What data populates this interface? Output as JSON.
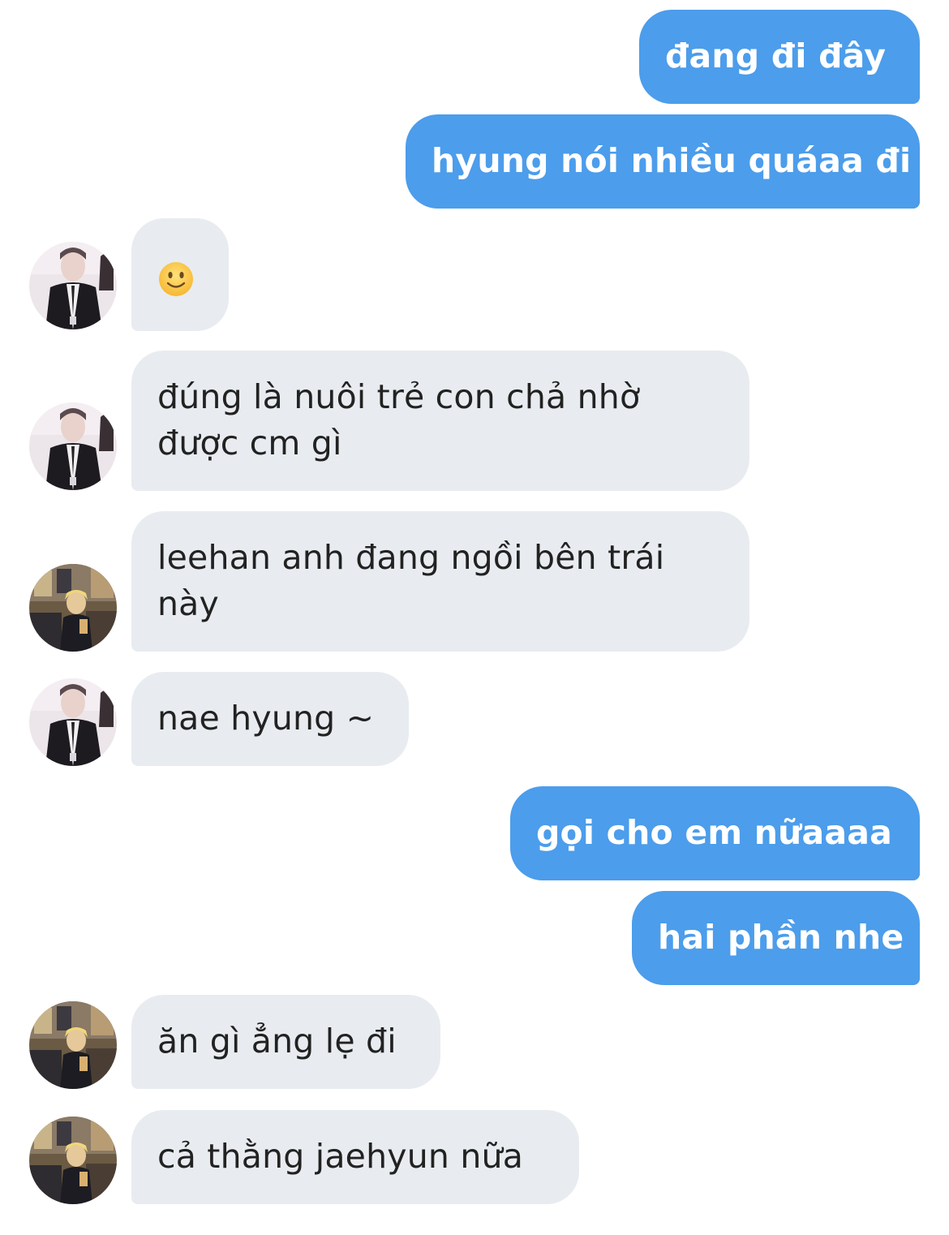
{
  "messages": [
    {
      "side": "out",
      "text": "đang đi đây"
    },
    {
      "side": "out",
      "text": "hyung nói nhiều quáaa đi"
    },
    {
      "side": "in",
      "avatar": "avatar-a",
      "emoji": "slightly-smiling-face-icon"
    },
    {
      "side": "in",
      "avatar": "avatar-a",
      "text": "đúng là nuôi trẻ con chả nhờ được cm gì"
    },
    {
      "side": "in",
      "avatar": "avatar-b",
      "text": "leehan anh đang ngồi bên trái này"
    },
    {
      "side": "in",
      "avatar": "avatar-a",
      "text": "nae hyung ~"
    },
    {
      "side": "out",
      "text": "gọi cho em nữaaaa"
    },
    {
      "side": "out",
      "text": "hai phần nhe"
    },
    {
      "side": "in",
      "avatar": "avatar-b",
      "text": "ăn gì ẳng lẹ đi"
    },
    {
      "side": "in",
      "avatar": "avatar-b",
      "text": "cả thằng jaehyun nữa"
    }
  ],
  "colors": {
    "outgoing_bubble": "#4c9deb",
    "incoming_bubble": "#e8ecf0",
    "incoming_text": "#222222",
    "outgoing_text": "#ffffff"
  }
}
